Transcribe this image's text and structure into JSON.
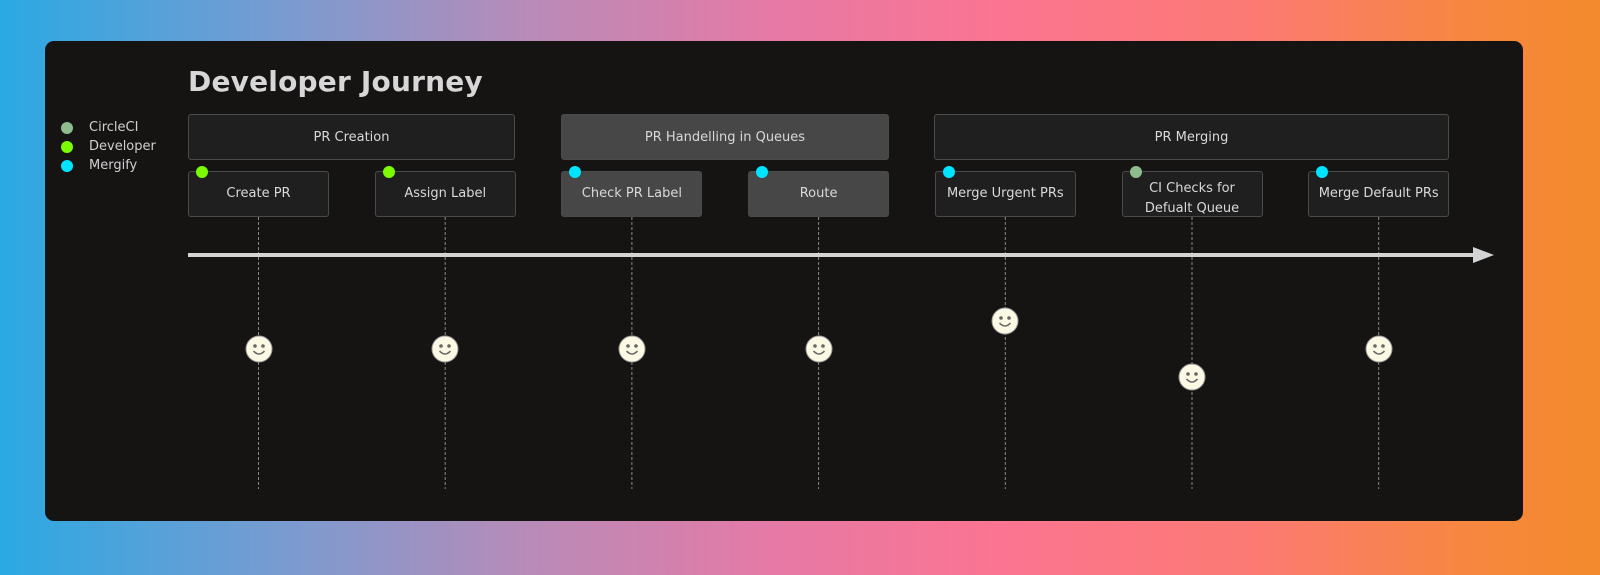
{
  "diagram": {
    "title": "Developer Journey",
    "actors": [
      {
        "name": "CircleCI",
        "color": "#8fbc8f"
      },
      {
        "name": "Developer",
        "color": "#7cfc00"
      },
      {
        "name": "Mergify",
        "color": "#00e5ff"
      }
    ],
    "sections": [
      {
        "label": "PR Creation",
        "style": "dark"
      },
      {
        "label": "PR Handelling in Queues",
        "style": "mid"
      },
      {
        "label": "PR Merging",
        "style": "dark"
      }
    ],
    "tasks": [
      {
        "label": "Create PR",
        "section": 0,
        "actor": "Developer",
        "score": 5,
        "mood": "happy"
      },
      {
        "label": "Assign Label",
        "section": 0,
        "actor": "Developer",
        "score": 5,
        "mood": "happy"
      },
      {
        "label": "Check PR Label",
        "section": 1,
        "actor": "Mergify",
        "score": 5,
        "mood": "happy"
      },
      {
        "label": "Route",
        "section": 1,
        "actor": "Mergify",
        "score": 5,
        "mood": "happy"
      },
      {
        "label": "Merge Urgent PRs",
        "section": 2,
        "actor": "Mergify",
        "score": 6,
        "mood": "happy"
      },
      {
        "label": "CI Checks for\nDefualt Queue",
        "section": 2,
        "actor": "CircleCI",
        "score": 4,
        "mood": "happy"
      },
      {
        "label": "Merge Default PRs",
        "section": 2,
        "actor": "Mergify",
        "score": 5,
        "mood": "happy"
      }
    ],
    "colors": {
      "panel": "#161313",
      "line": "#d4d4d4",
      "face": "#fbf8e4",
      "face_stroke": "#666666"
    }
  }
}
